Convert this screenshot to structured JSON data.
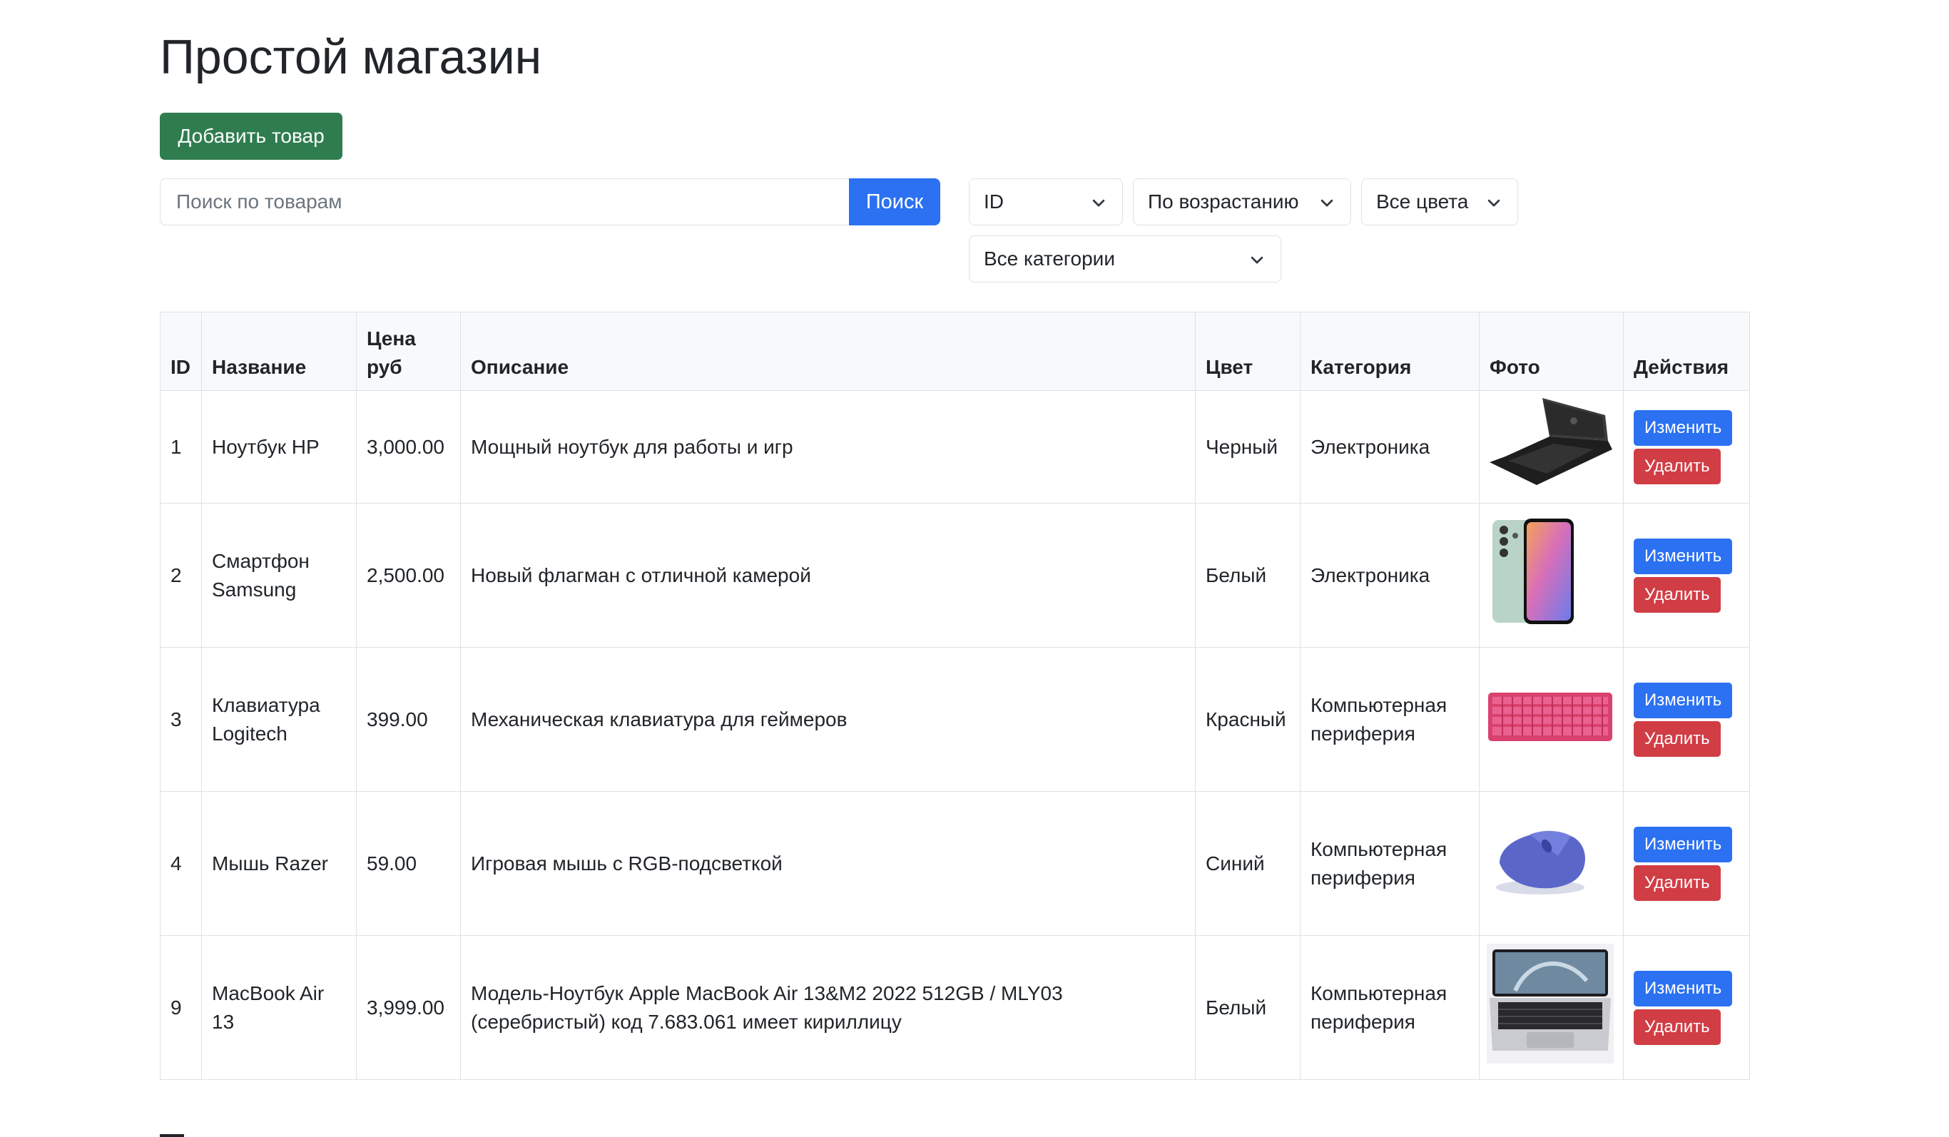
{
  "page": {
    "title": "Простой магазин"
  },
  "toolbar": {
    "add_label": "Добавить товар"
  },
  "search": {
    "placeholder": "Поиск по товарам",
    "value": "",
    "button_label": "Поиск"
  },
  "filters": {
    "sort_field": "ID",
    "sort_order": "По возрастанию",
    "color": "Все цвета",
    "category": "Все категории"
  },
  "table": {
    "headers": {
      "id": "ID",
      "name": "Название",
      "price": "Цена руб",
      "description": "Описание",
      "color": "Цвет",
      "category": "Категория",
      "photo": "Фото",
      "actions": "Действия"
    },
    "edit_label": "Изменить",
    "delete_label": "Удалить",
    "rows": [
      {
        "id": "1",
        "name": "Ноутбук HP",
        "price": "3,000.00",
        "description": "Мощный ноутбук для работы и игр",
        "color": "Черный",
        "category": "Электроника",
        "photo_icon": "laptop-photo-icon"
      },
      {
        "id": "2",
        "name": "Смартфон Samsung",
        "price": "2,500.00",
        "description": "Новый флагман с отличной камерой",
        "color": "Белый",
        "category": "Электроника",
        "photo_icon": "smartphone-photo-icon"
      },
      {
        "id": "3",
        "name": "Клавиатура Logitech",
        "price": "399.00",
        "description": "Механическая клавиатура для геймеров",
        "color": "Красный",
        "category": "Компьютерная периферия",
        "photo_icon": "keyboard-photo-icon"
      },
      {
        "id": "4",
        "name": "Мышь Razer",
        "price": "59.00",
        "description": "Игровая мышь с RGB-подсветкой",
        "color": "Синий",
        "category": "Компьютерная периферия",
        "photo_icon": "mouse-photo-icon"
      },
      {
        "id": "9",
        "name": "MacBook Air 13",
        "price": "3,999.00",
        "description": "Модель-Ноутбук Apple MacBook Air 13&M2 2022 512GB / MLY03 (серебристый) код 7.683.061 имеет кириллицу",
        "color": "Белый",
        "category": "Компьютерная периферия",
        "photo_icon": "macbook-photo-icon"
      }
    ]
  },
  "colors": {
    "success": "#2f7d4f",
    "primary": "#2b71f2",
    "danger": "#d13d45",
    "border": "#dee2e6",
    "text": "#212529"
  }
}
